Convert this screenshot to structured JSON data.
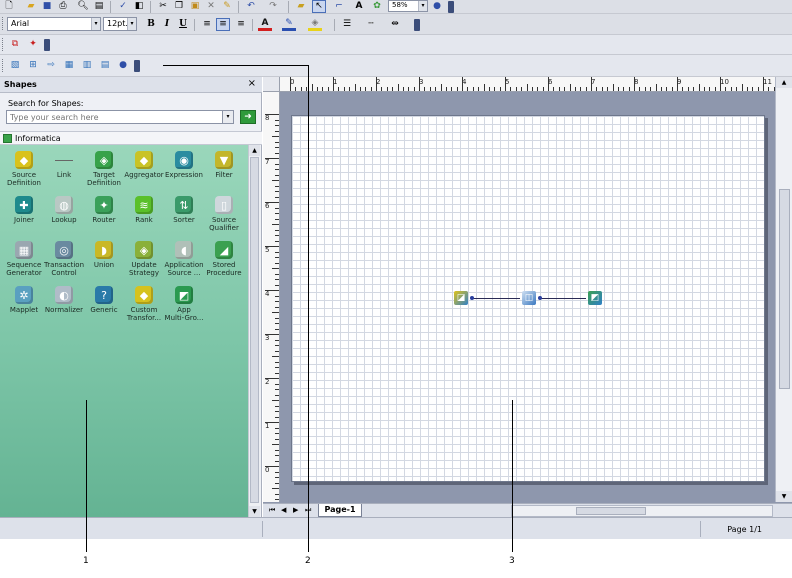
{
  "toolbars": {
    "font_name": "Arial",
    "font_size": "12pt.",
    "zoom": "58%"
  },
  "shapes_pane": {
    "title": "Shapes",
    "search_label": "Search for Shapes:",
    "search_placeholder": "Type your search here",
    "stencil_name": "Informatica",
    "shapes": [
      {
        "label": "Source\nDefinition",
        "icon": "source-definition-icon",
        "color": "#d9c21c"
      },
      {
        "label": "Link",
        "icon": "link-icon",
        "color": "#666666"
      },
      {
        "label": "Target\nDefinition",
        "icon": "target-definition-icon",
        "color": "#37a24a"
      },
      {
        "label": "Aggregator",
        "icon": "aggregator-icon",
        "color": "#c9c326"
      },
      {
        "label": "Expression",
        "icon": "expression-icon",
        "color": "#2a8ca0"
      },
      {
        "label": "Filter",
        "icon": "filter-icon",
        "color": "#c3b62a"
      },
      {
        "label": "Joiner",
        "icon": "joiner-icon",
        "color": "#1e8a8c"
      },
      {
        "label": "Lookup",
        "icon": "lookup-icon",
        "color": "#b9c8c4"
      },
      {
        "label": "Router",
        "icon": "router-icon",
        "color": "#3aa05a"
      },
      {
        "label": "Rank",
        "icon": "rank-icon",
        "color": "#5ac02a"
      },
      {
        "label": "Sorter",
        "icon": "sorter-icon",
        "color": "#3a9a6a"
      },
      {
        "label": "Source\nQualifier",
        "icon": "source-qualifier-icon",
        "color": "#cfd7dc"
      },
      {
        "label": "Sequence\nGenerator",
        "icon": "sequence-generator-icon",
        "color": "#9aa7b0"
      },
      {
        "label": "Transaction\nControl",
        "icon": "transaction-control-icon",
        "color": "#6a8aa0"
      },
      {
        "label": "Union",
        "icon": "union-icon",
        "color": "#c9b826"
      },
      {
        "label": "Update\nStrategy",
        "icon": "update-strategy-icon",
        "color": "#8ab03a"
      },
      {
        "label": "Application\nSource ...",
        "icon": "application-source-icon",
        "color": "#b0c0b8"
      },
      {
        "label": "Stored\nProcedure",
        "icon": "stored-procedure-icon",
        "color": "#3aa050"
      },
      {
        "label": "Mapplet",
        "icon": "mapplet-icon",
        "color": "#5aa0c0"
      },
      {
        "label": "Normalizer",
        "icon": "normalizer-icon",
        "color": "#b0bcc8"
      },
      {
        "label": "Generic",
        "icon": "generic-icon",
        "color": "#2a7aa8"
      },
      {
        "label": "Custom\nTransfor...",
        "icon": "custom-transformation-icon",
        "color": "#d6c21e"
      },
      {
        "label": "App\nMulti-Gro...",
        "icon": "app-multi-group-icon",
        "color": "#2a9a50"
      }
    ]
  },
  "ruler": {
    "top_numbers": [
      "0",
      "1",
      "2",
      "3",
      "4",
      "5",
      "6",
      "7",
      "8",
      "9",
      "10",
      "11"
    ],
    "left_numbers": [
      "8",
      "7",
      "6",
      "5",
      "4",
      "3",
      "2",
      "1",
      "0"
    ]
  },
  "page_tab": "Page-1",
  "status": {
    "page_indicator": "Page 1/1"
  },
  "callouts": [
    "1",
    "2",
    "3"
  ],
  "colors": {
    "stencil_green": "#7cc5a7",
    "canvas_backdrop": "#8e97ad"
  }
}
